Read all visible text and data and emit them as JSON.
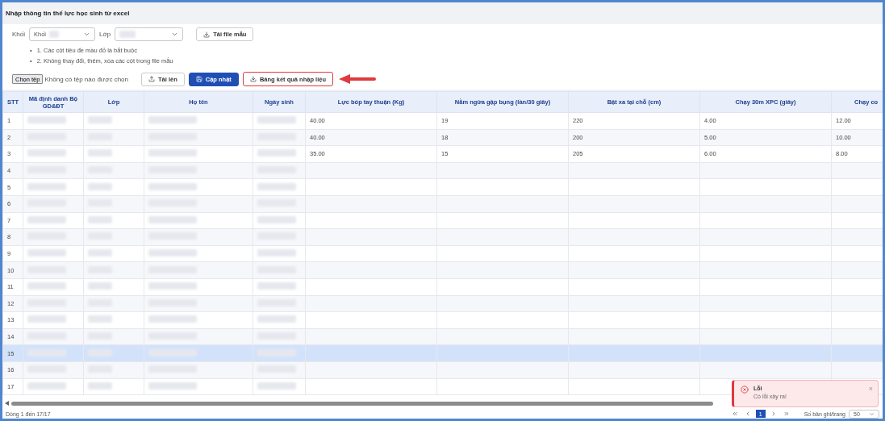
{
  "window": {
    "title": "Nhập thông tin thể lực học sinh từ excel"
  },
  "filters": [
    {
      "label": "Khối",
      "value": "Khối"
    },
    {
      "label": "Lớp"
    }
  ],
  "template_button": "Tải file mẫu",
  "notes": [
    {
      "bullet": "•",
      "text": "1. Các cột tiêu đề mầu đỏ là bắt buộc"
    },
    {
      "bullet": "•",
      "text": "2. Không thay đổi, thêm, xóa các cột trong file mẫu"
    }
  ],
  "file_input": {
    "button": "Chọn tệp",
    "status": "Không có tệp nào được chọn"
  },
  "actions": [
    {
      "label": "Tải lên",
      "kind": "upload"
    },
    {
      "label": "Cập nhật",
      "kind": "primary"
    },
    {
      "label": "Bảng kết quả nhập liệu",
      "kind": "highlighted"
    }
  ],
  "table": {
    "columns": [
      "STT",
      "Mã định danh Bộ GD&ĐT",
      "Lớp",
      "Họ tên",
      "Ngày sinh",
      "Lực bóp tay thuận (Kg)",
      "Nằm ngửa gập bụng (lần/30 giây)",
      "Bật xa tại chỗ (cm)",
      "Chạy 30m XPC (giây)",
      "Chạy co"
    ],
    "rows": [
      {
        "stt": "1",
        "selected": false,
        "values": [
          "40.00",
          "19",
          "220",
          "4.00",
          "12.00"
        ]
      },
      {
        "stt": "2",
        "selected": false,
        "values": [
          "40.00",
          "18",
          "200",
          "5.00",
          "10.00"
        ]
      },
      {
        "stt": "3",
        "selected": false,
        "values": [
          "35.00",
          "15",
          "205",
          "6.00",
          "8.00"
        ]
      },
      {
        "stt": "4",
        "selected": false
      },
      {
        "stt": "5",
        "selected": false
      },
      {
        "stt": "6",
        "selected": false
      },
      {
        "stt": "7",
        "selected": false
      },
      {
        "stt": "8",
        "selected": false
      },
      {
        "stt": "9",
        "selected": false
      },
      {
        "stt": "10",
        "selected": false
      },
      {
        "stt": "11",
        "selected": false
      },
      {
        "stt": "12",
        "selected": false
      },
      {
        "stt": "13",
        "selected": false
      },
      {
        "stt": "14",
        "selected": false
      },
      {
        "stt": "15",
        "selected": true
      },
      {
        "stt": "16",
        "selected": false
      },
      {
        "stt": "17",
        "selected": false
      }
    ]
  },
  "status_bar": {
    "range": "Dòng 1 đến 17/17",
    "pages": [
      {
        "label": "1",
        "selected": true
      }
    ],
    "page_size_label": "Số bản ghi/trang",
    "page_size": "50"
  },
  "toast": {
    "title": "Lỗi",
    "message": "Có lỗi xảy ra!",
    "close": "×"
  }
}
